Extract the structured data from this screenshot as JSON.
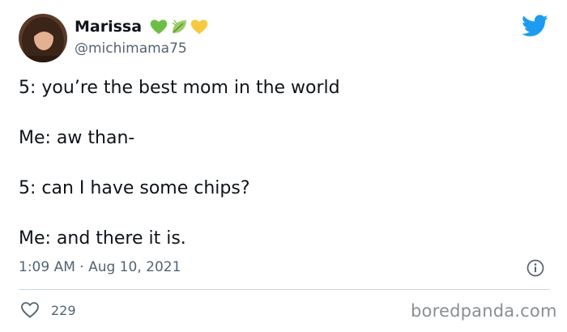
{
  "author": {
    "display_name": "Marissa",
    "handle": "@michimama75",
    "name_emojis": [
      "green-heart-icon",
      "leaf-icon",
      "yellow-heart-icon"
    ]
  },
  "tweet": {
    "lines": [
      "5: you’re the best mom in the world",
      "Me: aw than-",
      "5: can I have some chips?",
      "Me: and there it is."
    ],
    "timestamp": "1:09 AM · Aug 10, 2021"
  },
  "actions": {
    "like_count": "229"
  },
  "watermark": "boredpanda.com",
  "colors": {
    "twitter_blue": "#1d9bf0",
    "text_primary": "#0f1419",
    "text_secondary": "#536471",
    "green_heart": "#6cbf44",
    "yellow_heart": "#f7c940"
  }
}
